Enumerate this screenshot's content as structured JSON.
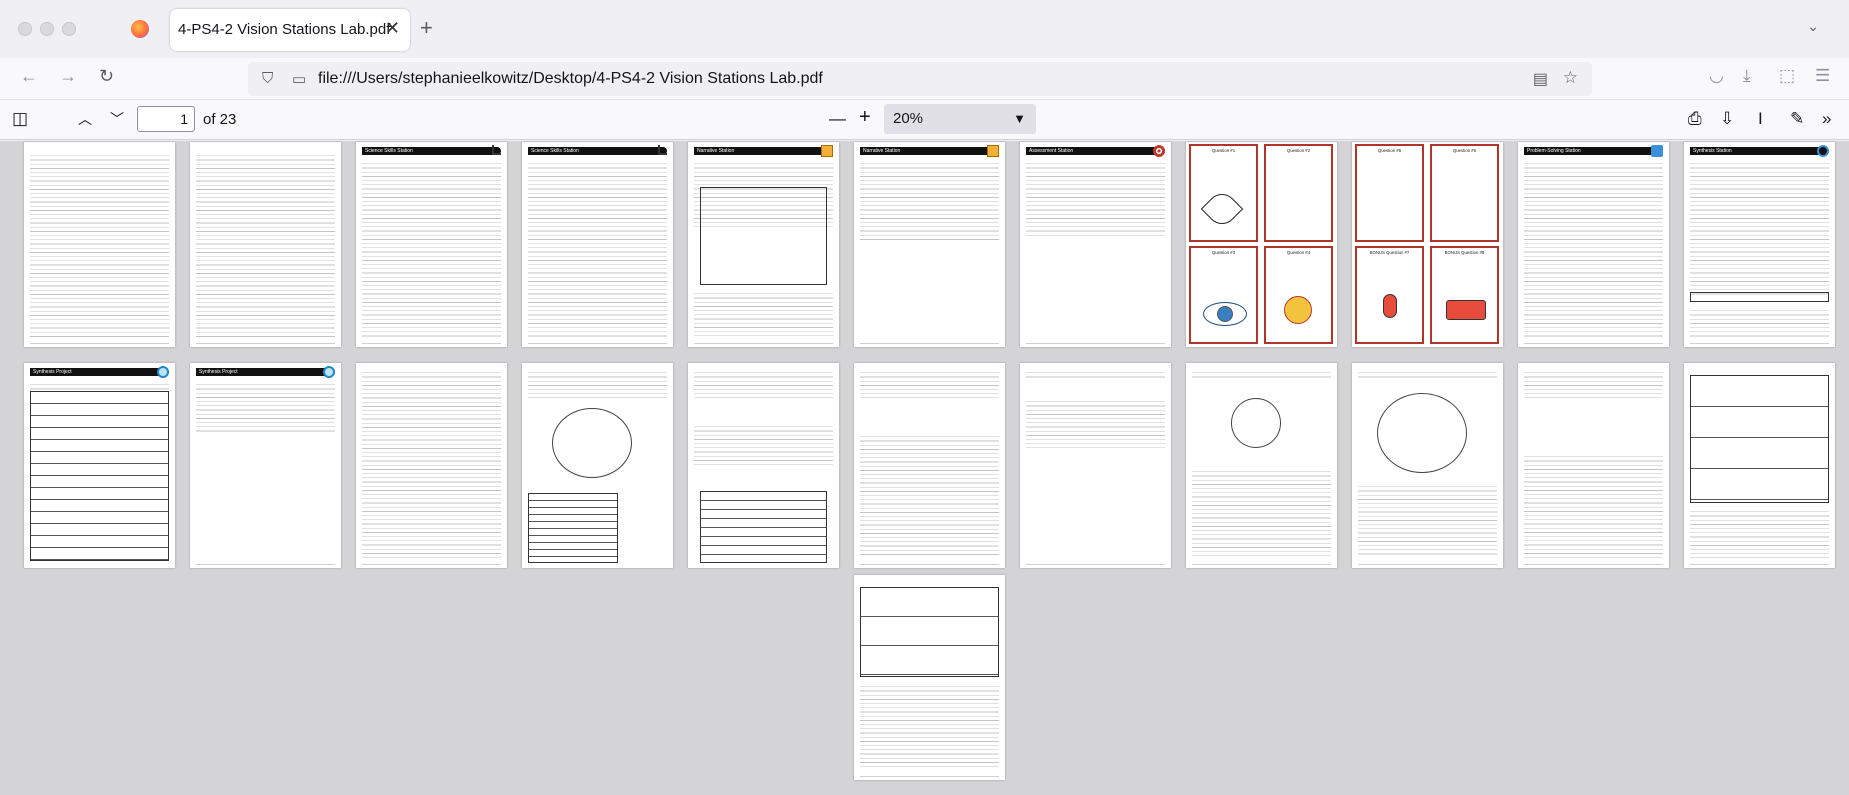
{
  "window": {
    "tab_title": "4-PS4-2 Vision Stations Lab.pdf",
    "close_glyph": "✕",
    "new_tab_glyph": "+",
    "tab_list_glyph": "⌄"
  },
  "navbar": {
    "back_glyph": "←",
    "forward_glyph": "→",
    "reload_glyph": "↻",
    "url": "file:///Users/stephanieelkowitz/Desktop/4-PS4-2 Vision Stations Lab.pdf"
  },
  "pdf_toolbar": {
    "page_number": "1",
    "page_count": "of 23",
    "zoom": "20%",
    "zoom_out_glyph": "—",
    "zoom_in_glyph": "+"
  },
  "thumbnails": {
    "station_headers": [
      "Science Skills Station",
      "Science Skills Station",
      "Narrative Station",
      "Narrative Station",
      "Assessment Station",
      "Problem-Solving Station",
      "Synthesis Station",
      "Synthesis Project",
      "Synthesis Project",
      "Synthesis Station"
    ],
    "question_cards_a": [
      "Question #1",
      "Question #2",
      "Question #3",
      "Question #4"
    ],
    "question_cards_b": [
      "Question #5",
      "Question #6",
      "BONUS Question #7",
      "BONUS Question #8"
    ]
  }
}
